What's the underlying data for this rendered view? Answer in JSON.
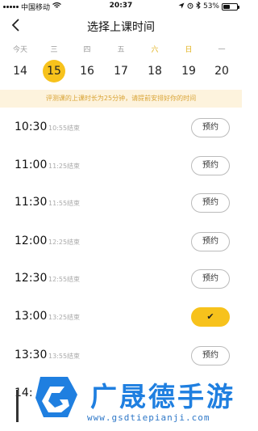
{
  "status_bar": {
    "carrier": "中国移动",
    "time": "20:37",
    "battery_text": "53%",
    "battery_level": 0.53
  },
  "nav": {
    "back_icon": "‹",
    "title": "选择上课时间"
  },
  "calendar": {
    "weekdays": [
      "今天",
      "三",
      "四",
      "五",
      "六",
      "日",
      "一"
    ],
    "dates": [
      "14",
      "15",
      "16",
      "17",
      "18",
      "19",
      "20"
    ],
    "selected_index": 1,
    "accent_color": "#f7c21c",
    "weekend_color": "#e2b21c"
  },
  "notice": "评测课的上课时长为25分钟，请提前安排好你的时间",
  "slots": [
    {
      "time": "10:30",
      "end": "10:55结束",
      "action": "预约",
      "booked": false
    },
    {
      "time": "11:00",
      "end": "11:25结束",
      "action": "预约",
      "booked": false
    },
    {
      "time": "11:30",
      "end": "11:55结束",
      "action": "预约",
      "booked": false
    },
    {
      "time": "12:00",
      "end": "12:25结束",
      "action": "预约",
      "booked": false
    },
    {
      "time": "12:30",
      "end": "12:55结束",
      "action": "预约",
      "booked": false
    },
    {
      "time": "13:00",
      "end": "13:25结束",
      "action": "✔",
      "booked": true
    },
    {
      "time": "13:30",
      "end": "13:55结束",
      "action": "预约",
      "booked": false
    },
    {
      "time": "14:",
      "end": "",
      "action": "",
      "booked": false
    }
  ],
  "watermark": {
    "name": "广晟德手游",
    "url": "www.gsdtiepianji.com"
  }
}
